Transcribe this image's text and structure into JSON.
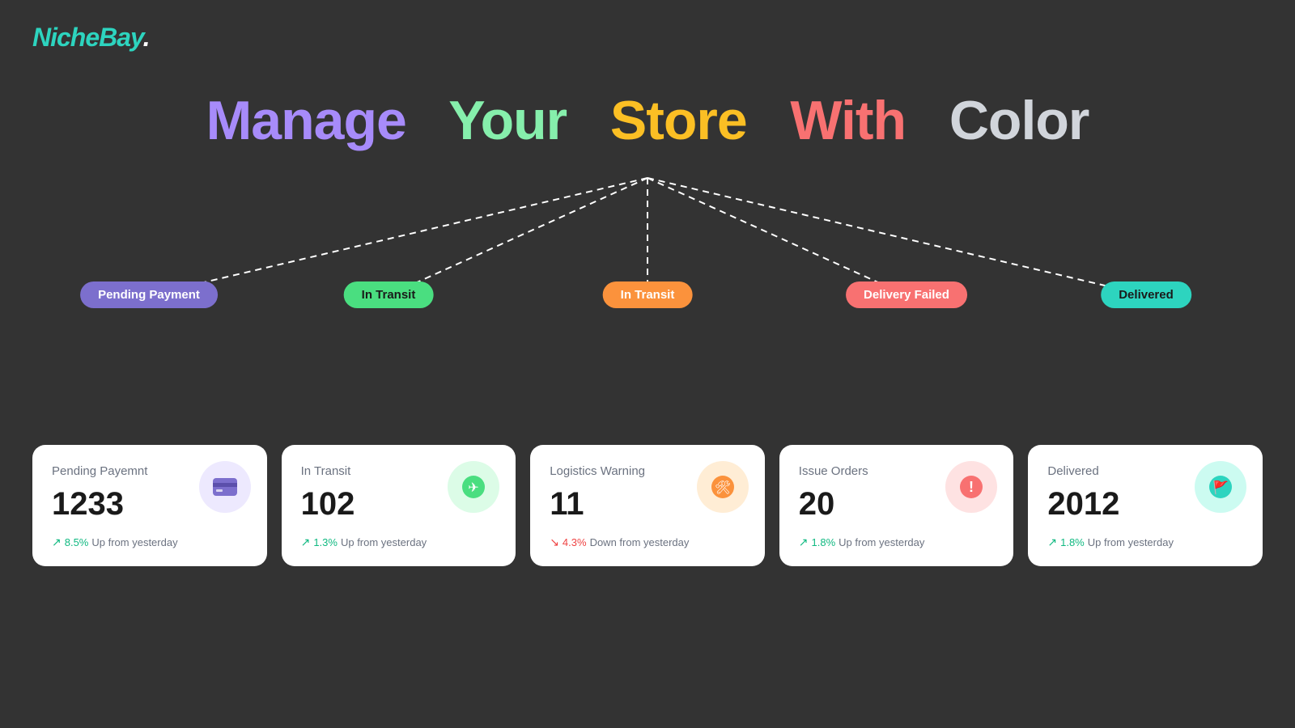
{
  "logo": {
    "text": "NicheBay",
    "dot": "."
  },
  "hero": {
    "words": [
      {
        "text": "Manage",
        "color": "#a78bfa"
      },
      {
        "text": "Your",
        "color": "#86efac"
      },
      {
        "text": "Store",
        "color": "#fbbf24"
      },
      {
        "text": "With",
        "color": "#f87171"
      },
      {
        "text": "Color",
        "color": "#d1d5db"
      }
    ]
  },
  "flowchart": {
    "badges": [
      {
        "label": "Pending Payment",
        "class": "badge-purple"
      },
      {
        "label": "In Transit",
        "class": "badge-green"
      },
      {
        "label": "In Transit",
        "class": "badge-orange"
      },
      {
        "label": "Delivery Failed",
        "class": "badge-red"
      },
      {
        "label": "Delivered",
        "class": "badge-teal"
      }
    ]
  },
  "cards": [
    {
      "title": "Pending Payemnt",
      "value": "1233",
      "trend_pct": "8.5%",
      "trend_dir": "up",
      "trend_label": "Up from yesterday",
      "icon": "💳",
      "icon_class": "icon-purple"
    },
    {
      "title": "In Transit",
      "value": "102",
      "trend_pct": "1.3%",
      "trend_dir": "up",
      "trend_label": "Up from yesterday",
      "icon": "✈",
      "icon_class": "icon-green"
    },
    {
      "title": "Logistics Warning",
      "value": "11",
      "trend_pct": "4.3%",
      "trend_dir": "down",
      "trend_label": "Down from yesterday",
      "icon": "🛠",
      "icon_class": "icon-orange"
    },
    {
      "title": "Issue Orders",
      "value": "20",
      "trend_pct": "1.8%",
      "trend_dir": "up",
      "trend_label": "Up from yesterday",
      "icon": "❗",
      "icon_class": "icon-red"
    },
    {
      "title": "Delivered",
      "value": "2012",
      "trend_pct": "1.8%",
      "trend_dir": "up",
      "trend_label": "Up from yesterday",
      "icon": "🚩",
      "icon_class": "icon-teal"
    }
  ]
}
